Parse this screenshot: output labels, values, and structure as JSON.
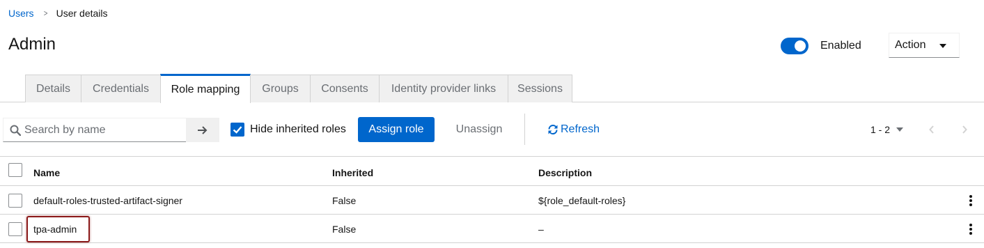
{
  "breadcrumb": {
    "parent": "Users",
    "current": "User details"
  },
  "page": {
    "title": "Admin"
  },
  "header": {
    "enabled_label": "Enabled",
    "enabled": true,
    "action_label": "Action"
  },
  "tabs": [
    {
      "label": "Details"
    },
    {
      "label": "Credentials"
    },
    {
      "label": "Role mapping",
      "active": true
    },
    {
      "label": "Groups"
    },
    {
      "label": "Consents"
    },
    {
      "label": "Identity provider links"
    },
    {
      "label": "Sessions"
    }
  ],
  "toolbar": {
    "search_placeholder": "Search by name",
    "hide_inherited_label": "Hide inherited roles",
    "hide_inherited_checked": true,
    "assign_label": "Assign role",
    "unassign_label": "Unassign",
    "refresh_label": "Refresh",
    "pagination": "1 - 2"
  },
  "table": {
    "columns": [
      "Name",
      "Inherited",
      "Description"
    ],
    "rows": [
      {
        "name": "default-roles-trusted-artifact-signer",
        "inherited": "False",
        "description": "${role_default-roles}"
      },
      {
        "name": "tpa-admin",
        "inherited": "False",
        "description": "–"
      }
    ]
  },
  "colors": {
    "accent": "#0066cc",
    "highlight": "#8b1a1a"
  },
  "icons": [
    "chevron-right-icon",
    "caret-down-icon",
    "search-icon",
    "arrow-right-icon",
    "check-icon",
    "sync-icon",
    "angle-left-icon",
    "angle-right-icon",
    "kebab-icon"
  ]
}
